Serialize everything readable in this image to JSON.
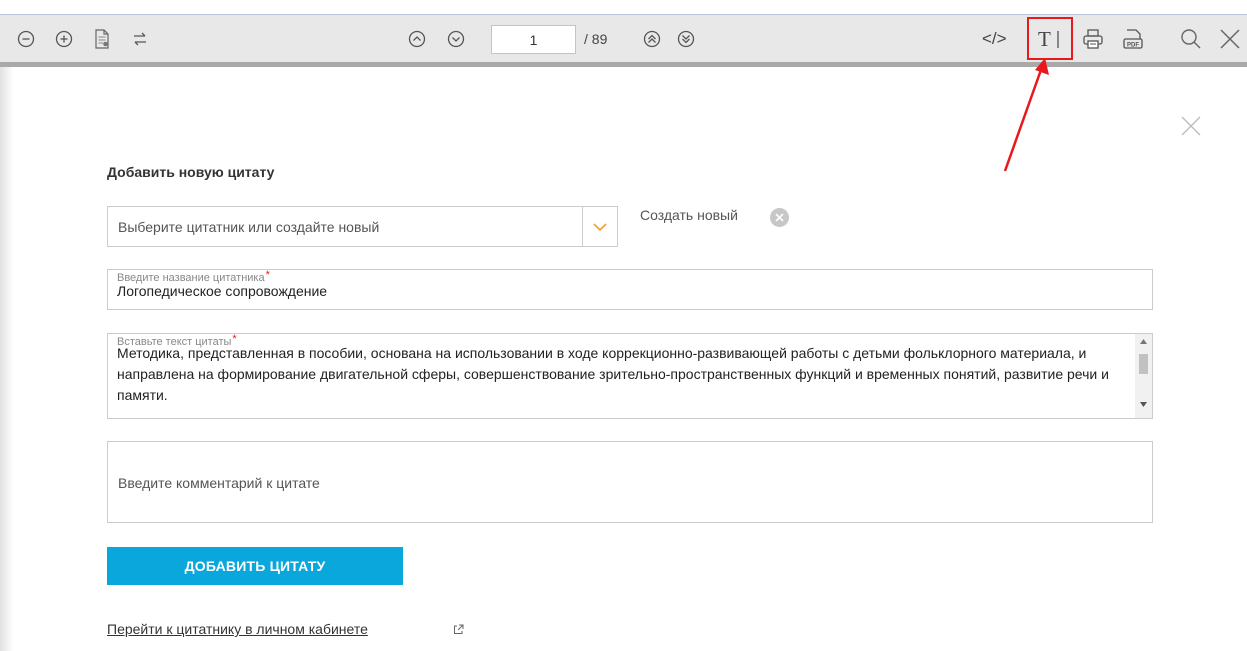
{
  "toolbar": {
    "page_current": "1",
    "page_total": "/ 89",
    "icons": [
      "zoom-out-icon",
      "zoom-in-icon",
      "document-icon",
      "swap-icon",
      "page-up-icon",
      "page-down-icon",
      "first-page-icon",
      "last-page-icon",
      "code-icon",
      "text-select-icon",
      "print-icon",
      "pdf-icon",
      "search-icon",
      "close-icon"
    ]
  },
  "annotation": {
    "highlight_color": "#e8191d"
  },
  "form": {
    "title": "Добавить новую цитату",
    "select_placeholder": "Выберите цитатник или создайте новый",
    "create_new_label": "Создать новый",
    "name_label": "Введите название цитатника",
    "name_value": "Логопедическое сопровождение",
    "quote_label": "Вставьте текст цитаты",
    "quote_text": "Методика, представленная в пособии, основана на использовании в ходе коррекционно-развивающей работы с детьми фольклорного материала, и направлена на формирование двигательной сферы, совершенствование зрительно-пространственных функций и временных понятий, развитие речи и памяти.",
    "comment_placeholder": "Введите комментарий к цитате",
    "submit_label": "ДОБАВИТЬ ЦИТАТУ",
    "cabinet_link": "Перейти к цитатнику в личном кабинете",
    "required_mark": "*"
  },
  "colors": {
    "accent": "#0aa7dd",
    "toolbar_bg": "#e8e8e8",
    "required": "#e8191d"
  }
}
